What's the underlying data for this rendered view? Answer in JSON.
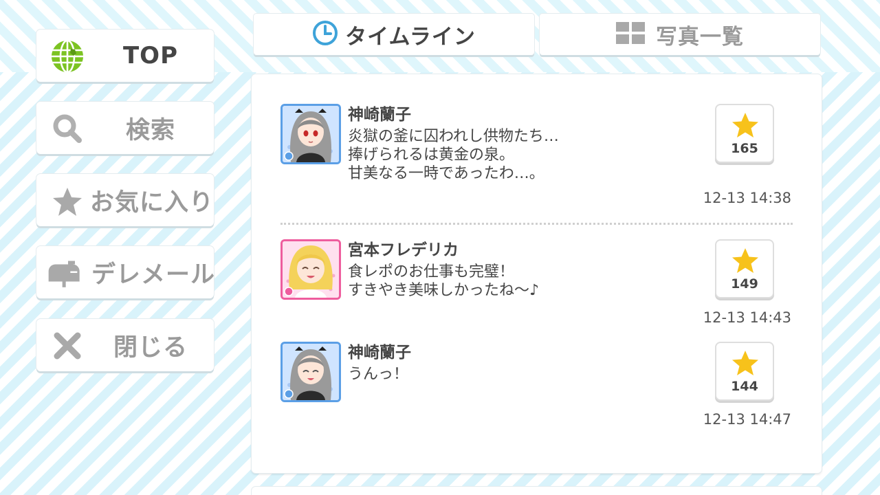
{
  "sidebar": {
    "items": [
      {
        "label": "TOP",
        "icon": "globe-icon",
        "active": true
      },
      {
        "label": "検索",
        "icon": "search-icon"
      },
      {
        "label": "お気に入り",
        "icon": "star-icon"
      },
      {
        "label": "デレメール",
        "icon": "mailbox-icon"
      },
      {
        "label": "閉じる",
        "icon": "close-icon"
      }
    ]
  },
  "tabs": [
    {
      "label": "タイムライン",
      "icon": "clock-icon",
      "active": true
    },
    {
      "label": "写真一覧",
      "icon": "grid-icon",
      "active": false
    }
  ],
  "posts": [
    {
      "name": "神崎蘭子",
      "body_lines": [
        "炎獄の釜に囚われし供物たち…",
        "捧げられるは黄金の泉。",
        "甘美なる一時であったわ…。"
      ],
      "likes": "165",
      "time": "12-13 14:38",
      "avatar": "avatar-ranko"
    },
    {
      "name": "宮本フレデリカ",
      "body_lines": [
        "食レポのお仕事も完璧！",
        "すきやき美味しかったね～♪"
      ],
      "likes": "149",
      "time": "12-13 14:43",
      "avatar": "avatar-frederica"
    },
    {
      "name": "神崎蘭子",
      "body_lines": [
        "うんっ！"
      ],
      "likes": "144",
      "time": "12-13 14:47",
      "avatar": "avatar-ranko"
    }
  ],
  "colors": {
    "text_dark": "#454545",
    "text_muted": "#9a9a9a",
    "accent_blue": "#3ea3d9",
    "star_gold": "#f7c21b",
    "cool_attr": "#5b9fe6",
    "cute_attr": "#ee5d9e",
    "globe_green": "#7cc322"
  }
}
